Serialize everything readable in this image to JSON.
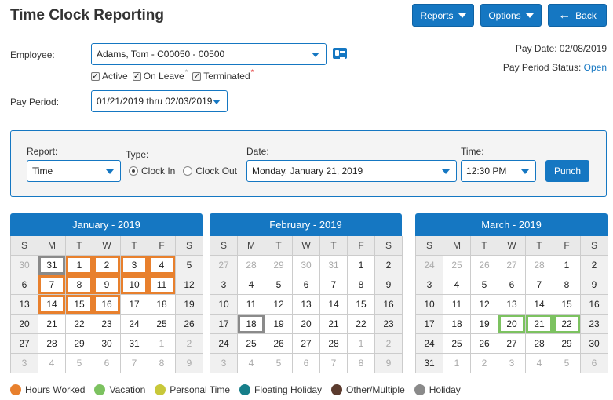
{
  "page": {
    "title": "Time Clock Reporting"
  },
  "toolbar": {
    "reports_label": "Reports",
    "options_label": "Options",
    "back_label": "Back"
  },
  "employee": {
    "label": "Employee:",
    "value": "Adams, Tom  - C00050 - 00500",
    "filters": [
      {
        "label": "Active",
        "checked": true
      },
      {
        "label": "On Leave",
        "checked": true
      },
      {
        "label": "Terminated",
        "checked": true
      }
    ]
  },
  "pay_info": {
    "pay_date": "Pay Date: 02/08/2019",
    "status_label": "Pay Period Status:",
    "status_value": "Open"
  },
  "pay_period": {
    "label": "Pay Period:",
    "value": "01/21/2019 thru 02/03/2019"
  },
  "punch_panel": {
    "report_label": "Report:",
    "report_value": "Time",
    "type_label": "Type:",
    "type_options": [
      "Clock In",
      "Clock Out"
    ],
    "type_selected": "Clock In",
    "date_label": "Date:",
    "date_value": "Monday, January 21, 2019",
    "time_label": "Time:",
    "time_value": "12:30 PM",
    "punch_label": "Punch"
  },
  "days_of_week": [
    "S",
    "M",
    "T",
    "W",
    "T",
    "F",
    "S"
  ],
  "colors": {
    "hours_worked": "#e8802d",
    "vacation": "#7cc260",
    "personal_time": "#c8c83a",
    "floating_holiday": "#177f8a",
    "other_multiple": "#5b3b2e",
    "holiday": "#8a8a8a",
    "accent": "#1577c2"
  },
  "calendars": [
    {
      "title": "January - 2019",
      "weeks": [
        [
          [
            "30",
            "o"
          ],
          [
            "31",
            "hol"
          ],
          [
            "1",
            "hw"
          ],
          [
            "2",
            "hw"
          ],
          [
            "3",
            "hw"
          ],
          [
            "4",
            "hw"
          ],
          [
            "5",
            ""
          ]
        ],
        [
          [
            "6",
            ""
          ],
          [
            "7",
            "hw"
          ],
          [
            "8",
            "hw"
          ],
          [
            "9",
            "hw"
          ],
          [
            "10",
            "hw"
          ],
          [
            "11",
            "hw"
          ],
          [
            "12",
            ""
          ]
        ],
        [
          [
            "13",
            ""
          ],
          [
            "14",
            "hw"
          ],
          [
            "15",
            "hw"
          ],
          [
            "16",
            "hw"
          ],
          [
            "17",
            ""
          ],
          [
            "18",
            ""
          ],
          [
            "19",
            ""
          ]
        ],
        [
          [
            "20",
            ""
          ],
          [
            "21",
            ""
          ],
          [
            "22",
            ""
          ],
          [
            "23",
            ""
          ],
          [
            "24",
            ""
          ],
          [
            "25",
            ""
          ],
          [
            "26",
            ""
          ]
        ],
        [
          [
            "27",
            ""
          ],
          [
            "28",
            ""
          ],
          [
            "29",
            ""
          ],
          [
            "30",
            ""
          ],
          [
            "31",
            ""
          ],
          [
            "1",
            "o"
          ],
          [
            "2",
            "o"
          ]
        ],
        [
          [
            "3",
            "o"
          ],
          [
            "4",
            "o"
          ],
          [
            "5",
            "o"
          ],
          [
            "6",
            "o"
          ],
          [
            "7",
            "o"
          ],
          [
            "8",
            "o"
          ],
          [
            "9",
            "o"
          ]
        ]
      ]
    },
    {
      "title": "February - 2019",
      "weeks": [
        [
          [
            "27",
            "o"
          ],
          [
            "28",
            "o"
          ],
          [
            "29",
            "o"
          ],
          [
            "30",
            "o"
          ],
          [
            "31",
            "o"
          ],
          [
            "1",
            ""
          ],
          [
            "2",
            ""
          ]
        ],
        [
          [
            "3",
            ""
          ],
          [
            "4",
            ""
          ],
          [
            "5",
            ""
          ],
          [
            "6",
            ""
          ],
          [
            "7",
            ""
          ],
          [
            "8",
            ""
          ],
          [
            "9",
            ""
          ]
        ],
        [
          [
            "10",
            ""
          ],
          [
            "11",
            ""
          ],
          [
            "12",
            ""
          ],
          [
            "13",
            ""
          ],
          [
            "14",
            ""
          ],
          [
            "15",
            ""
          ],
          [
            "16",
            ""
          ]
        ],
        [
          [
            "17",
            ""
          ],
          [
            "18",
            "hol"
          ],
          [
            "19",
            ""
          ],
          [
            "20",
            ""
          ],
          [
            "21",
            ""
          ],
          [
            "22",
            ""
          ],
          [
            "23",
            ""
          ]
        ],
        [
          [
            "24",
            ""
          ],
          [
            "25",
            ""
          ],
          [
            "26",
            ""
          ],
          [
            "27",
            ""
          ],
          [
            "28",
            ""
          ],
          [
            "1",
            "o"
          ],
          [
            "2",
            "o"
          ]
        ],
        [
          [
            "3",
            "o"
          ],
          [
            "4",
            "o"
          ],
          [
            "5",
            "o"
          ],
          [
            "6",
            "o"
          ],
          [
            "7",
            "o"
          ],
          [
            "8",
            "o"
          ],
          [
            "9",
            "o"
          ]
        ]
      ]
    },
    {
      "title": "March - 2019",
      "weeks": [
        [
          [
            "24",
            "o"
          ],
          [
            "25",
            "o"
          ],
          [
            "26",
            "o"
          ],
          [
            "27",
            "o"
          ],
          [
            "28",
            "o"
          ],
          [
            "1",
            ""
          ],
          [
            "2",
            ""
          ]
        ],
        [
          [
            "3",
            ""
          ],
          [
            "4",
            ""
          ],
          [
            "5",
            ""
          ],
          [
            "6",
            ""
          ],
          [
            "7",
            ""
          ],
          [
            "8",
            ""
          ],
          [
            "9",
            ""
          ]
        ],
        [
          [
            "10",
            ""
          ],
          [
            "11",
            ""
          ],
          [
            "12",
            ""
          ],
          [
            "13",
            ""
          ],
          [
            "14",
            ""
          ],
          [
            "15",
            ""
          ],
          [
            "16",
            ""
          ]
        ],
        [
          [
            "17",
            ""
          ],
          [
            "18",
            ""
          ],
          [
            "19",
            ""
          ],
          [
            "20",
            "vac"
          ],
          [
            "21",
            "vac"
          ],
          [
            "22",
            "vac"
          ],
          [
            "23",
            ""
          ]
        ],
        [
          [
            "24",
            ""
          ],
          [
            "25",
            ""
          ],
          [
            "26",
            ""
          ],
          [
            "27",
            ""
          ],
          [
            "28",
            ""
          ],
          [
            "29",
            ""
          ],
          [
            "30",
            ""
          ]
        ],
        [
          [
            "31",
            ""
          ],
          [
            "1",
            "o"
          ],
          [
            "2",
            "o"
          ],
          [
            "3",
            "o"
          ],
          [
            "4",
            "o"
          ],
          [
            "5",
            "o"
          ],
          [
            "6",
            "o"
          ]
        ]
      ]
    }
  ],
  "legend": [
    {
      "label": "Hours Worked",
      "color": "#e8802d"
    },
    {
      "label": "Vacation",
      "color": "#7cc260"
    },
    {
      "label": "Personal Time",
      "color": "#c8c83a"
    },
    {
      "label": "Floating Holiday",
      "color": "#177f8a"
    },
    {
      "label": "Other/Multiple",
      "color": "#5b3b2e"
    },
    {
      "label": "Holiday",
      "color": "#8a8a8a"
    }
  ]
}
